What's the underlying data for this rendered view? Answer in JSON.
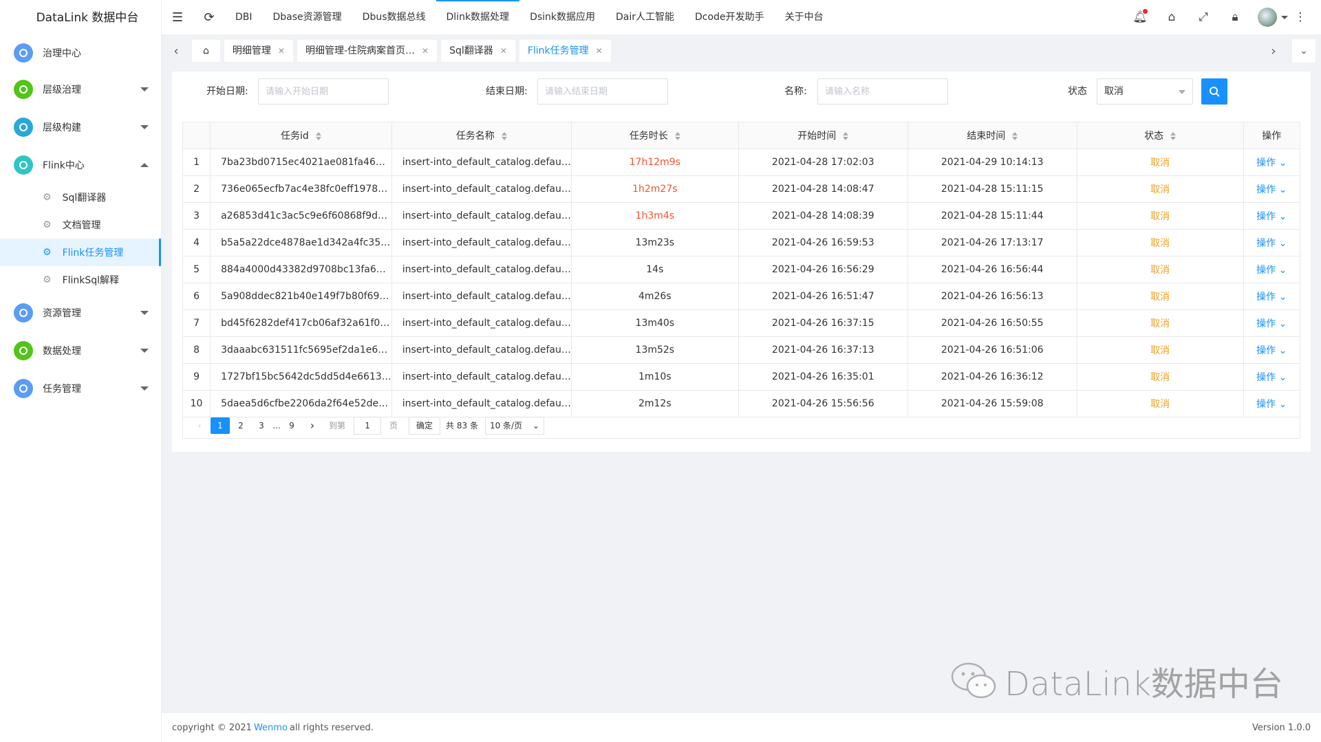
{
  "app": {
    "title": "DataLink 数据中台"
  },
  "sidebar": {
    "items": [
      {
        "label": "治理中心",
        "color": "#5b9cf5"
      },
      {
        "label": "层级治理",
        "color": "#52c41a"
      },
      {
        "label": "层级构建",
        "color": "#2aa7d8"
      },
      {
        "label": "Flink中心",
        "color": "#2fc5c5"
      },
      {
        "label": "资源管理",
        "color": "#5b9cf5"
      },
      {
        "label": "数据处理",
        "color": "#52c41a"
      },
      {
        "label": "任务管理",
        "color": "#5b9cf5"
      }
    ],
    "flink_sub": [
      "Sql翻译器",
      "文档管理",
      "Flink任务管理",
      "FlinkSql解释"
    ]
  },
  "header": {
    "nav": [
      "DBI",
      "Dbase资源管理",
      "Dbus数据总线",
      "Dlink数据处理",
      "Dsink数据应用",
      "Dair人工智能",
      "Dcode开发助手",
      "关于中台"
    ],
    "active_nav": "Dlink数据处理"
  },
  "tabs": [
    "明细管理",
    "明细管理-住院病案首页…",
    "Sql翻译器",
    "Flink任务管理"
  ],
  "filters": {
    "start_label": "开始日期:",
    "start_placeholder": "请输入开始日期",
    "end_label": "结束日期:",
    "end_placeholder": "请输入结束日期",
    "name_label": "名称:",
    "name_placeholder": "请输入名称",
    "status_label": "状态",
    "status_value": "取消"
  },
  "table": {
    "headers": [
      "任务id",
      "任务名称",
      "任务时长",
      "开始时间",
      "结束时间",
      "状态",
      "操作"
    ],
    "rows": [
      {
        "no": "1",
        "id": "7ba23bd0715ec4021ae081fa46…",
        "name": "insert-into_default_catalog.defau…",
        "dur": "17h12m9s",
        "red": true,
        "start": "2021-04-28 17:02:03",
        "end": "2021-04-29 10:14:13",
        "status": "取消",
        "op": "操作"
      },
      {
        "no": "2",
        "id": "736e065ecfb7ac4e38fc0eff1978…",
        "name": "insert-into_default_catalog.defau…",
        "dur": "1h2m27s",
        "red": true,
        "start": "2021-04-28 14:08:47",
        "end": "2021-04-28 15:11:15",
        "status": "取消",
        "op": "操作"
      },
      {
        "no": "3",
        "id": "a26853d41c3ac5c9e6f60868f9d…",
        "name": "insert-into_default_catalog.defau…",
        "dur": "1h3m4s",
        "red": true,
        "start": "2021-04-28 14:08:39",
        "end": "2021-04-28 15:11:44",
        "status": "取消",
        "op": "操作"
      },
      {
        "no": "4",
        "id": "b5a5a22dce4878ae1d342a4fc35…",
        "name": "insert-into_default_catalog.defau…",
        "dur": "13m23s",
        "red": false,
        "start": "2021-04-26 16:59:53",
        "end": "2021-04-26 17:13:17",
        "status": "取消",
        "op": "操作"
      },
      {
        "no": "5",
        "id": "884a4000d43382d9708bc13fa6…",
        "name": "insert-into_default_catalog.defau…",
        "dur": "14s",
        "red": false,
        "start": "2021-04-26 16:56:29",
        "end": "2021-04-26 16:56:44",
        "status": "取消",
        "op": "操作"
      },
      {
        "no": "6",
        "id": "5a908ddec821b40e149f7b80f69…",
        "name": "insert-into_default_catalog.defau…",
        "dur": "4m26s",
        "red": false,
        "start": "2021-04-26 16:51:47",
        "end": "2021-04-26 16:56:13",
        "status": "取消",
        "op": "操作"
      },
      {
        "no": "7",
        "id": "bd45f6282def417cb06af32a61f0…",
        "name": "insert-into_default_catalog.defau…",
        "dur": "13m40s",
        "red": false,
        "start": "2021-04-26 16:37:15",
        "end": "2021-04-26 16:50:55",
        "status": "取消",
        "op": "操作"
      },
      {
        "no": "8",
        "id": "3daaabc631511fc5695ef2da1e6…",
        "name": "insert-into_default_catalog.defau…",
        "dur": "13m52s",
        "red": false,
        "start": "2021-04-26 16:37:13",
        "end": "2021-04-26 16:51:06",
        "status": "取消",
        "op": "操作"
      },
      {
        "no": "9",
        "id": "1727bf15bc5642dc5dd5d4e6613…",
        "name": "insert-into_default_catalog.defau…",
        "dur": "1m10s",
        "red": false,
        "start": "2021-04-26 16:35:01",
        "end": "2021-04-26 16:36:12",
        "status": "取消",
        "op": "操作"
      },
      {
        "no": "10",
        "id": "5daea5d6cfbe2206da2f64e52de…",
        "name": "insert-into_default_catalog.defau…",
        "dur": "2m12s",
        "red": false,
        "start": "2021-04-26 15:56:56",
        "end": "2021-04-26 15:59:08",
        "status": "取消",
        "op": "操作"
      }
    ]
  },
  "pagination": {
    "pages": [
      "1",
      "2",
      "3",
      "…",
      "9"
    ],
    "current": "1",
    "goto_label": "到第",
    "goto_value": "1",
    "page_unit": "页",
    "confirm": "确定",
    "total": "共 83 条",
    "page_size": "10 条/页"
  },
  "watermark": "DataLink数据中台",
  "footer": {
    "copyright_prefix": "copyright © 2021",
    "link": "Wenmo",
    "copyright_suffix": "all rights reserved.",
    "version": "Version 1.0.0"
  },
  "colors": {
    "accent": "#1890ff",
    "danger": "#f5542e",
    "warning": "#f0a020"
  }
}
